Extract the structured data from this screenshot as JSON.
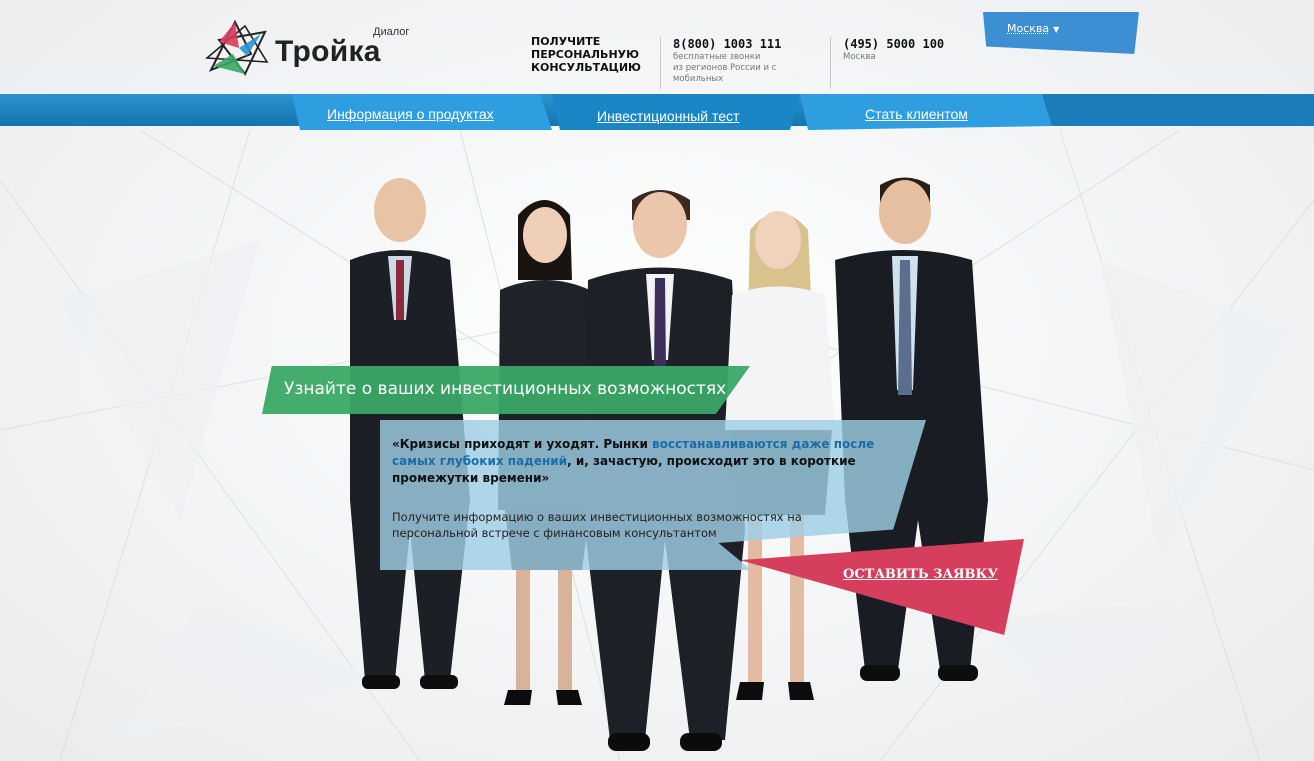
{
  "brand": {
    "name": "Тройка",
    "sup": "Диалог"
  },
  "header": {
    "consult_line1": "ПОЛУЧИТЕ",
    "consult_line2": "ПЕРСОНАЛЬНУЮ",
    "consult_line3": "КОНСУЛЬТАЦИЮ",
    "phone1": {
      "number": "8(800) 1003 111",
      "sub1": "бесплатные звонки",
      "sub2": "из регионов России и с",
      "sub3": "мобильных"
    },
    "phone2": {
      "number": "(495) 5000 100",
      "sub1": "Москва"
    },
    "city": {
      "label": "Москва",
      "caret": "▼"
    }
  },
  "nav": [
    {
      "label": "Информация о продуктах"
    },
    {
      "label": "Инвестиционный тест"
    },
    {
      "label": "Стать клиентом"
    }
  ],
  "hero": {
    "banner": "Узнайте о ваших инвестиционных возможностях",
    "quote_part1": "«Кризисы приходят и уходят. Рынки ",
    "quote_highlight": "восстанавливаются даже после самых глубоких падений",
    "quote_part2": ", и, зачастую, происходит это в короткие промежутки времени»",
    "info": "Получите информацию о ваших инвестиционных возможностях на персональной встрече с финансовым консультантом",
    "cta": "ОСТАВИТЬ ЗАЯВКУ"
  },
  "colors": {
    "nav_blue": "#1b82bf",
    "nav_tab_blue": "#2994d6",
    "banner_green": "#3aa865",
    "quote_blue": "#9fcee4",
    "cta_red": "#d63e5d",
    "highlight_blue": "#1a6ea6"
  }
}
